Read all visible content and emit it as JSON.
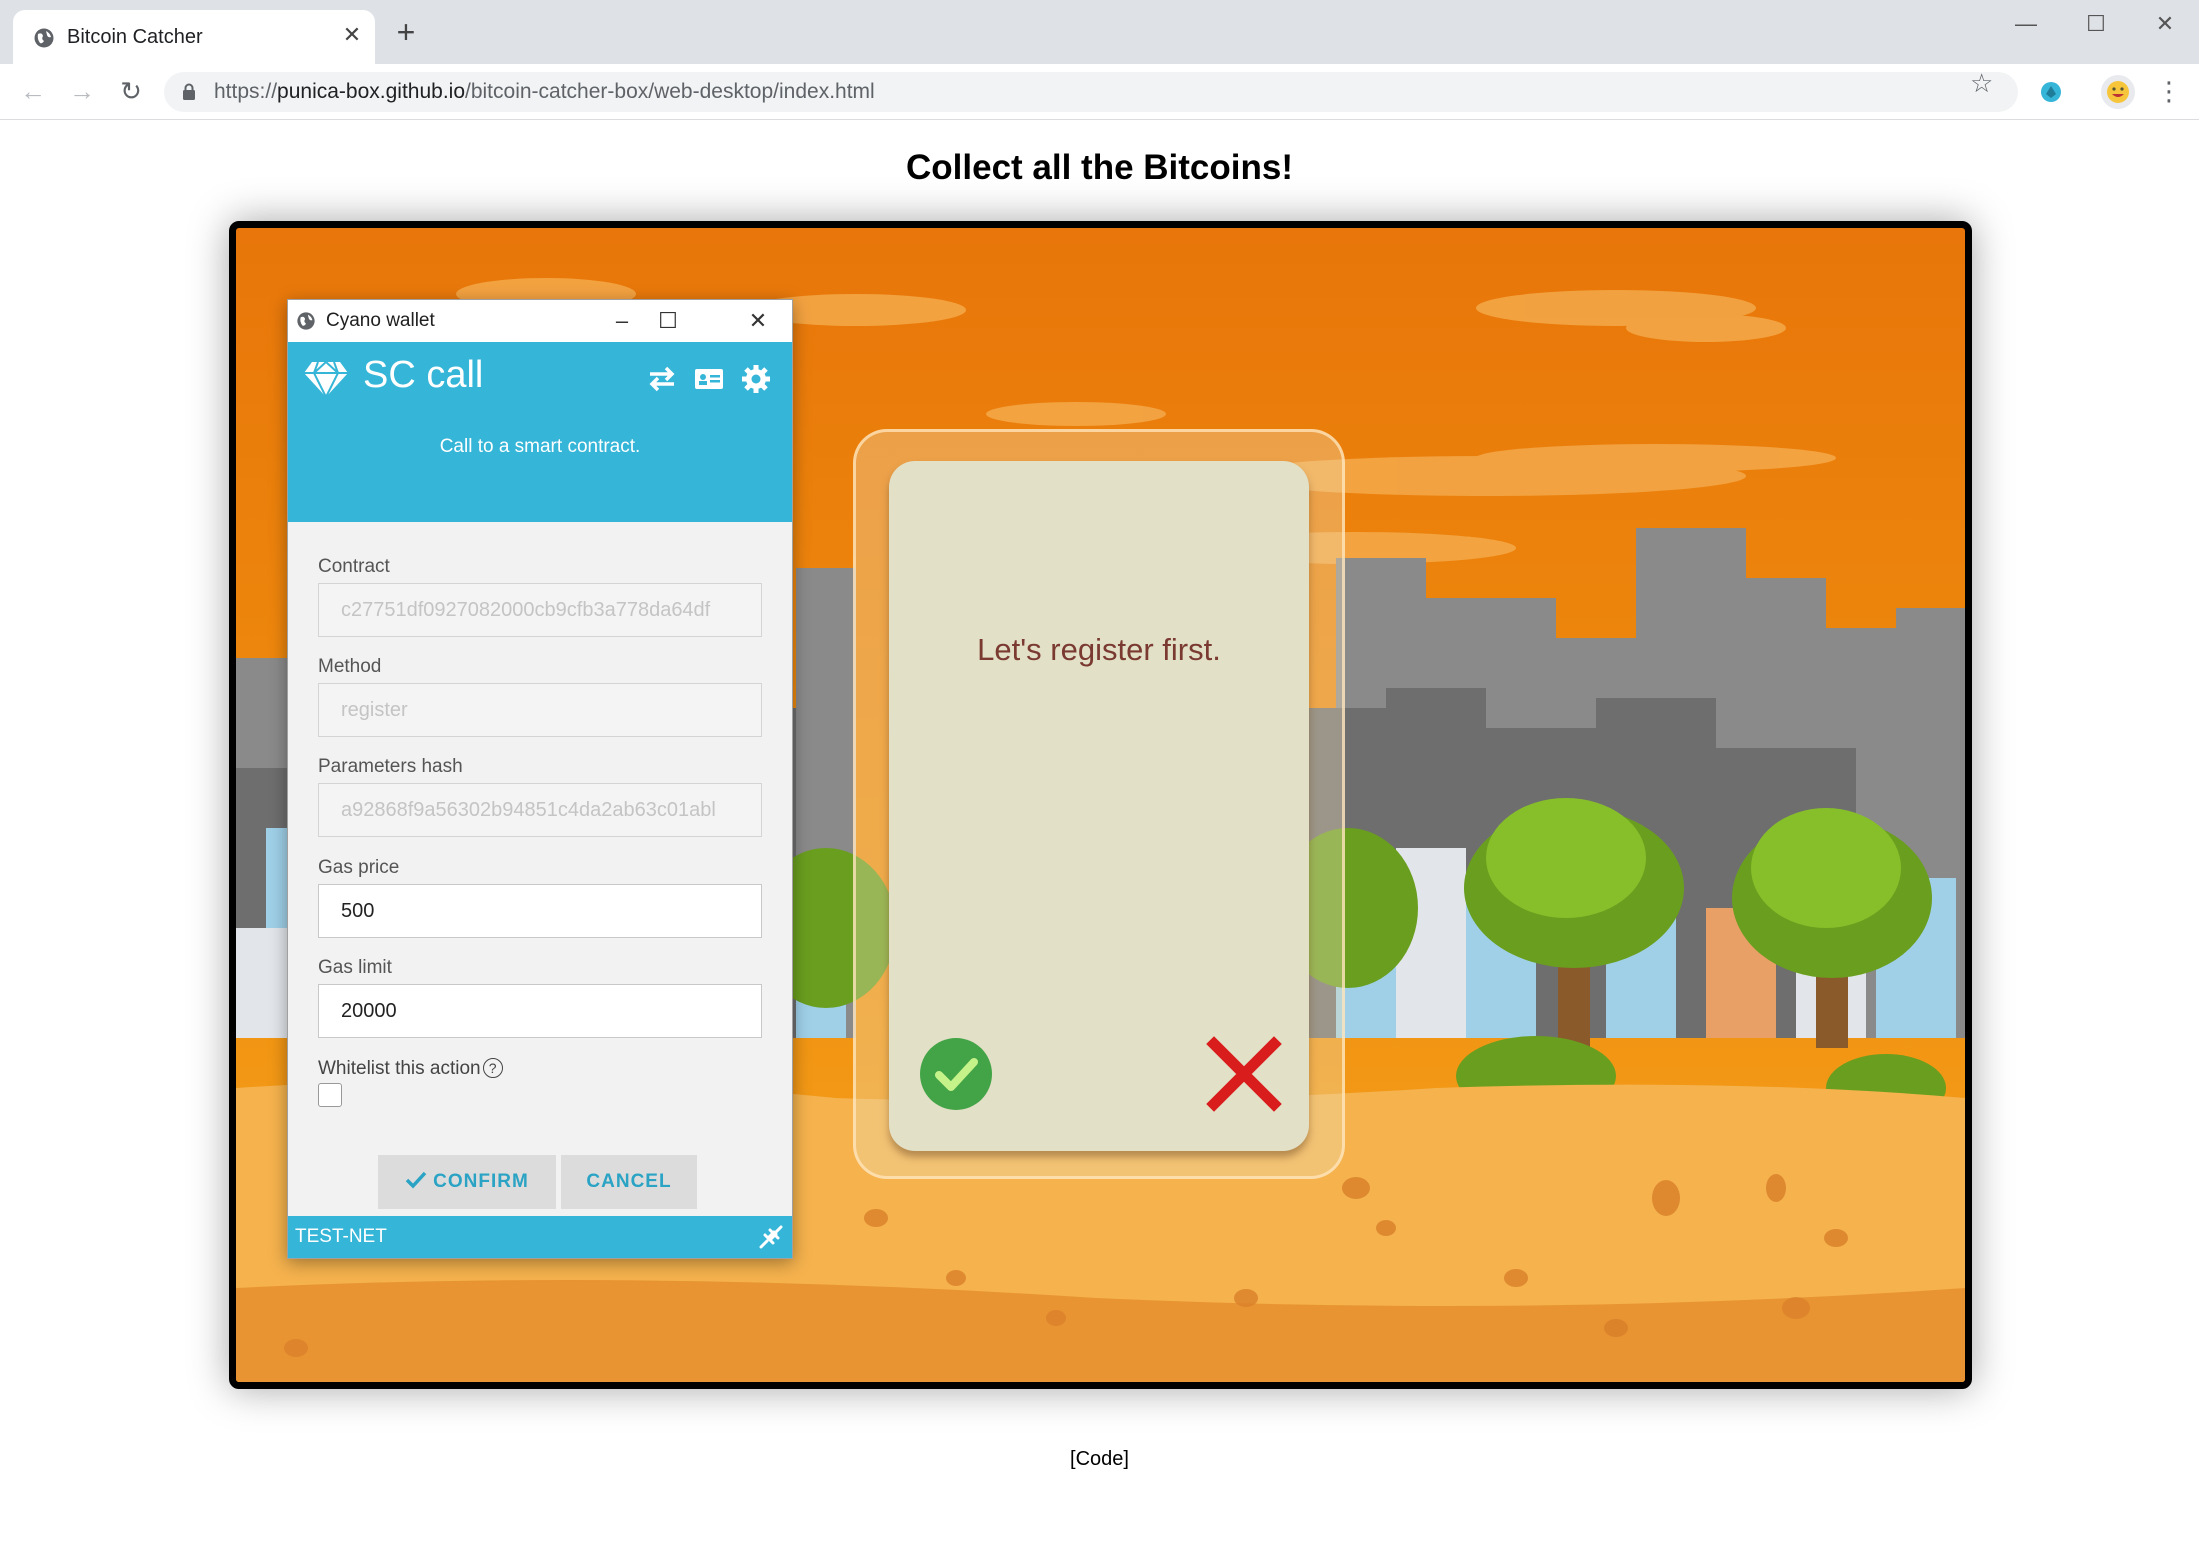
{
  "browser": {
    "tab_title": "Bitcoin Catcher",
    "url_scheme": "https://",
    "url_host": "punica-box.github.io",
    "url_path": "/bitcoin-catcher-box/web-desktop/index.html"
  },
  "page": {
    "title": "Collect all the Bitcoins!",
    "code_link": "[Code]"
  },
  "game": {
    "card_message": "Let's register first."
  },
  "wallet": {
    "window_title": "Cyano wallet",
    "heading": "SC call",
    "subtitle": "Call to a smart contract.",
    "fields": {
      "contract_label": "Contract",
      "contract_value": "c27751df0927082000cb9cfb3a778da64df",
      "method_label": "Method",
      "method_value": "register",
      "params_label": "Parameters hash",
      "params_value": "a92868f9a56302b94851c4da2ab63c01abl",
      "gas_price_label": "Gas price",
      "gas_price_value": "500",
      "gas_limit_label": "Gas limit",
      "gas_limit_value": "20000",
      "whitelist_label": "Whitelist this action",
      "help_glyph": "?"
    },
    "confirm_label": "CONFIRM",
    "cancel_label": "CANCEL",
    "network": "TEST-NET"
  },
  "colors": {
    "wallet_accent": "#35b5d7",
    "game_sky": "#e8760a",
    "card_bg": "#e2e0c6",
    "ok_green": "#43a447",
    "reject_red": "#d91c1c"
  },
  "icons": [
    "globe-icon",
    "close-icon",
    "plus-icon",
    "back-icon",
    "forward-icon",
    "reload-icon",
    "lock-icon",
    "star-icon",
    "extension-icon",
    "avatar",
    "menu-icon",
    "diamond-icon",
    "transfer-icon",
    "id-card-icon",
    "gear-icon",
    "check-icon",
    "x-icon",
    "plug-icon"
  ]
}
